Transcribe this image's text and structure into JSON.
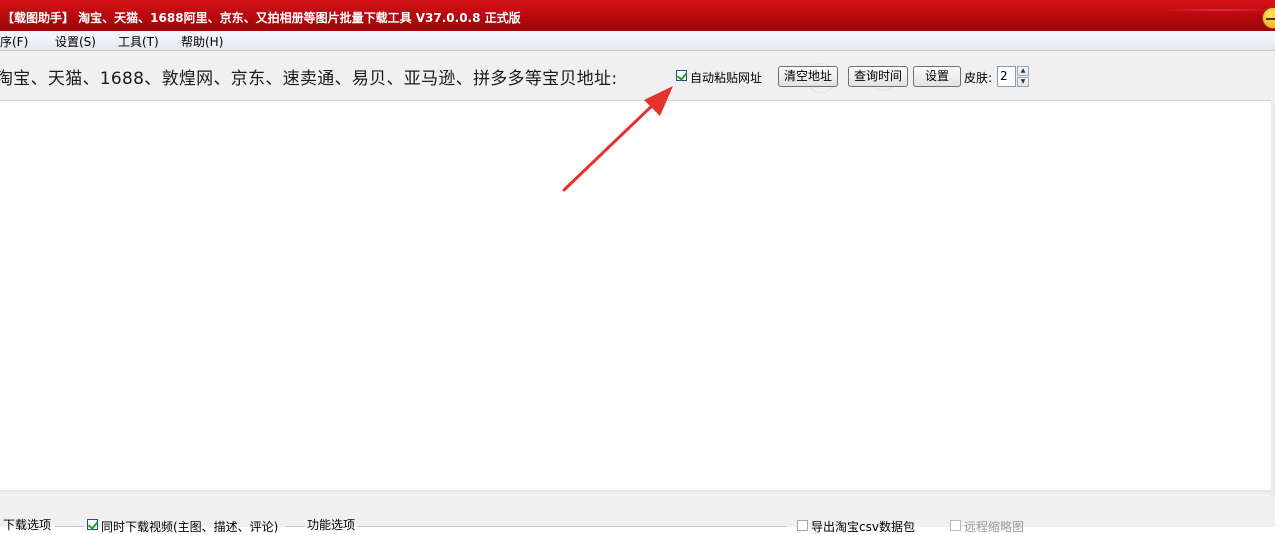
{
  "window": {
    "title": "【载图助手】 淘宝、天猫、1688阿里、京东、又拍相册等图片批量下载工具 V37.0.0.8 正式版"
  },
  "menu": {
    "items": [
      {
        "label": "程序(F)"
      },
      {
        "label": "设置(S)"
      },
      {
        "label": "工具(T)"
      },
      {
        "label": "帮助(H)"
      }
    ]
  },
  "toolbar": {
    "address_label": "淘宝、天猫、1688、敦煌网、京东、速卖通、易贝、亚马逊、拼多多等宝贝地址:",
    "auto_paste_label": "自动粘贴网址",
    "auto_paste_checked": true,
    "clear_button": "清空地址",
    "query_button": "查询时间",
    "settings_button": "设置",
    "skin_label": "皮肤:",
    "skin_value": "2"
  },
  "bottom": {
    "download_options": "下载选项",
    "also_download_video": "同时下载视频(主图、描述、评论)",
    "feature_options": "功能选项",
    "export_csv": "导出淘宝csv数据包",
    "remote_thumb": "远程缩略图"
  },
  "colors": {
    "titlebar": "#c20b12",
    "checkmark": "#21a121",
    "annotation_arrow": "#e8302c"
  }
}
